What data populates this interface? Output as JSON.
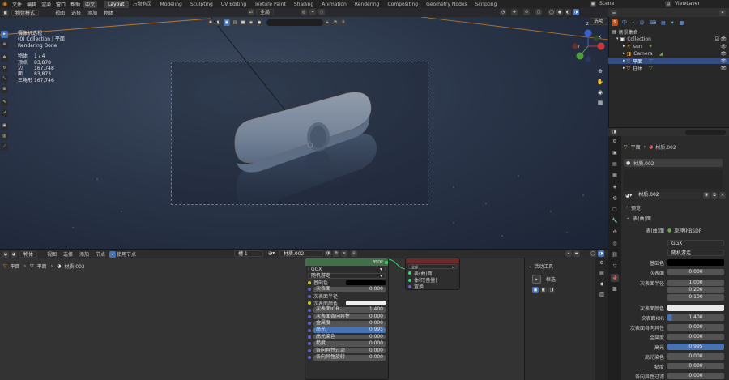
{
  "topbar": {
    "menus": [
      "文件",
      "编辑",
      "渲染",
      "窗口",
      "帮助",
      "中文"
    ],
    "workspaces": [
      "Layout",
      "万物有灵",
      "Modeling",
      "Sculpting",
      "UV Editing",
      "Texture Paint",
      "Shading",
      "Animation",
      "Rendering",
      "Compositing",
      "Geometry Nodes",
      "Scripting"
    ],
    "scene": "Scene",
    "view_layer": "ViewLayer"
  },
  "viewport": {
    "mode": "物体模式",
    "menus": [
      "视图",
      "选择",
      "添加",
      "物体"
    ],
    "orientation": "全局",
    "options": "选项",
    "info": {
      "title": "摄像机透视",
      "collection": "(0) Collection | 平面",
      "status": "Rendering Done",
      "stats": [
        {
          "k": "物体",
          "v": "1 / 4"
        },
        {
          "k": "顶点",
          "v": "83,878"
        },
        {
          "k": "边",
          "v": "167,748"
        },
        {
          "k": "面",
          "v": "83,873"
        },
        {
          "k": "三角形",
          "v": "167,746"
        }
      ]
    },
    "gizmo": {
      "x": "X",
      "y": "Y",
      "z": "Z"
    }
  },
  "outliner": {
    "items": [
      {
        "label": "场景集合",
        "level": 0,
        "icon": "scene-collection-icon",
        "selected": false
      },
      {
        "label": "Collection",
        "level": 1,
        "icon": "collection-icon",
        "selected": false
      },
      {
        "label": "sun",
        "level": 2,
        "icon": "light-icon",
        "selected": false
      },
      {
        "label": "Camera",
        "level": 2,
        "icon": "camera-icon",
        "selected": false
      },
      {
        "label": "平面",
        "level": 2,
        "icon": "mesh-icon",
        "selected": true
      },
      {
        "label": "柱体",
        "level": 2,
        "icon": "mesh-icon",
        "selected": false
      }
    ]
  },
  "properties": {
    "breadcrumb_obj": "平面",
    "breadcrumb_mat": "材质.002",
    "slot": "材质.002",
    "material": "材质.002",
    "sections": {
      "preview": "预览",
      "surface": "表(曲)面"
    },
    "surface_label": "表(曲)面",
    "surface_value": "原理化BSDF",
    "distribution": "GGX",
    "subsurface_method": "随机游走",
    "fields": [
      {
        "label": "基础色",
        "value": "",
        "kind": "black"
      },
      {
        "label": "次表面",
        "value": "0.000",
        "kind": "normal"
      },
      {
        "label": "次表面半径",
        "value": "1.000",
        "kind": "normal"
      },
      {
        "label": "",
        "value": "0.200",
        "kind": "normal"
      },
      {
        "label": "",
        "value": "0.100",
        "kind": "normal"
      },
      {
        "label": "次表面颜色",
        "value": "",
        "kind": "white"
      },
      {
        "label": "次表面IOR",
        "value": "1.400",
        "kind": "blue"
      },
      {
        "label": "次表面各向异性",
        "value": "0.000",
        "kind": "normal"
      },
      {
        "label": "金属度",
        "value": "0.000",
        "kind": "normal"
      },
      {
        "label": "高光",
        "value": "0.995",
        "kind": "blue"
      },
      {
        "label": "高光染色",
        "value": "0.000",
        "kind": "normal"
      },
      {
        "label": "糙度",
        "value": "0.000",
        "kind": "normal"
      },
      {
        "label": "各向异性过滤",
        "value": "0.000",
        "kind": "normal"
      }
    ]
  },
  "node_editor": {
    "type": "物体",
    "menus": [
      "视图",
      "选择",
      "添加",
      "节点"
    ],
    "use_nodes": "使用节点",
    "slot": "槽 1",
    "material": "材质.002",
    "breadcrumb": [
      "平面",
      "平面",
      "材质.002"
    ],
    "bsdf_node": {
      "distribution": "GGX",
      "method": "随机游走",
      "rows": [
        {
          "label": "基础色",
          "value": "",
          "kind": "swatch-black"
        },
        {
          "label": "次表面",
          "value": "0.000",
          "kind": "slider"
        },
        {
          "label": "次表面半径",
          "value": "",
          "kind": "label"
        },
        {
          "label": "次表面颜色",
          "value": "",
          "kind": "swatch-white"
        },
        {
          "label": "次表面IOR",
          "value": "1.400",
          "kind": "slider"
        },
        {
          "label": "次表面各向异性",
          "value": "0.000",
          "kind": "slider"
        },
        {
          "label": "金属度",
          "value": "0.000",
          "kind": "slider"
        },
        {
          "label": "高光",
          "value": "0.995",
          "kind": "slider-blue"
        },
        {
          "label": "高光染色",
          "value": "0.000",
          "kind": "slider"
        },
        {
          "label": "糙度",
          "value": "0.000",
          "kind": "slider"
        },
        {
          "label": "各向异性过滤",
          "value": "0.000",
          "kind": "slider"
        },
        {
          "label": "各向异性旋转",
          "value": "0.000",
          "kind": "slider"
        }
      ]
    },
    "output_node": {
      "target": "全部",
      "sockets": [
        "表(曲)面",
        "体积(音量)",
        "置换"
      ]
    },
    "active_tool": {
      "title": "活动工具",
      "tool": "框选"
    }
  }
}
